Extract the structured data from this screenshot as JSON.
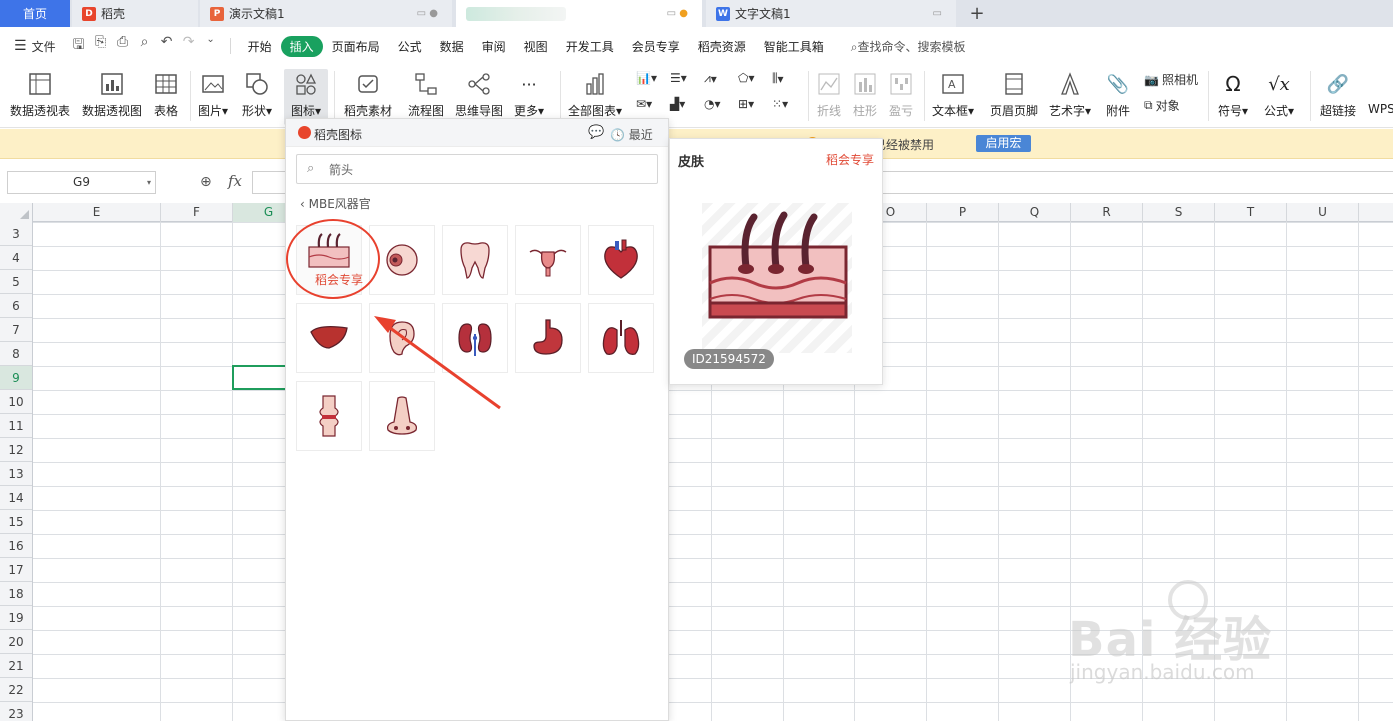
{
  "tabs": {
    "home": "首页",
    "docer": "稻壳",
    "ppt": "演示文稿1",
    "word": "文字文稿1",
    "add": "+"
  },
  "menu": {
    "file": "文件",
    "items": [
      "开始",
      "插入",
      "页面布局",
      "公式",
      "数据",
      "审阅",
      "视图",
      "开发工具",
      "会员专享",
      "稻壳资源",
      "智能工具箱"
    ],
    "search": "查找命令、搜索模板"
  },
  "ribbon": {
    "pivot_table": "数据透视表",
    "pivot_chart": "数据透视图",
    "table": "表格",
    "picture": "图片",
    "shape": "形状",
    "icon": "图标",
    "docer_material": "稻壳素材",
    "flowchart": "流程图",
    "mindmap": "思维导图",
    "more": "更多",
    "all_charts": "全部图表",
    "line": "折线",
    "column": "柱形",
    "winloss": "盈亏",
    "textbox": "文本框",
    "header_footer": "页眉页脚",
    "wordart": "艺术字",
    "attachment": "附件",
    "camera": "照相机",
    "object": "对象",
    "symbol": "符号",
    "formula": "公式",
    "hyperlink": "超链接",
    "wps": "WPS"
  },
  "macro": {
    "text": "宏已经被禁用",
    "button": "启用宏"
  },
  "formula_bar": {
    "cell_ref": "G9",
    "fx": "fx"
  },
  "grid": {
    "cols_left": [
      "E",
      "F",
      "G"
    ],
    "cols_right": [
      "O",
      "P",
      "Q",
      "R",
      "S",
      "T",
      "U"
    ],
    "rows": [
      "3",
      "4",
      "5",
      "6",
      "7",
      "8",
      "9",
      "10",
      "11",
      "12",
      "13",
      "14",
      "15",
      "16",
      "17",
      "18",
      "19",
      "20",
      "21",
      "22",
      "23"
    ]
  },
  "icon_panel": {
    "title": "稻壳图标",
    "recent": "最近",
    "search_value": "箭头",
    "back_label": "MBE风器官",
    "vip_label": "稻会专享",
    "icons": [
      "skin-icon",
      "eye-icon",
      "tooth-icon",
      "uterus-icon",
      "heart-icon",
      "liver-icon",
      "ear-icon",
      "kidney-icon",
      "stomach-icon",
      "lung-icon",
      "joint-icon",
      "nose-icon"
    ]
  },
  "preview": {
    "title": "皮肤",
    "vip": "稻会专享",
    "id": "ID21594572"
  },
  "watermark": {
    "main": "Bai 经验",
    "sub": "jingyan.baidu.com"
  },
  "colors": {
    "accent_green": "#19a15f",
    "home_tab": "#3e74e8",
    "vip_red": "#e04a36",
    "circle_red": "#e8412e",
    "macro_bg": "#fdf0c7"
  }
}
